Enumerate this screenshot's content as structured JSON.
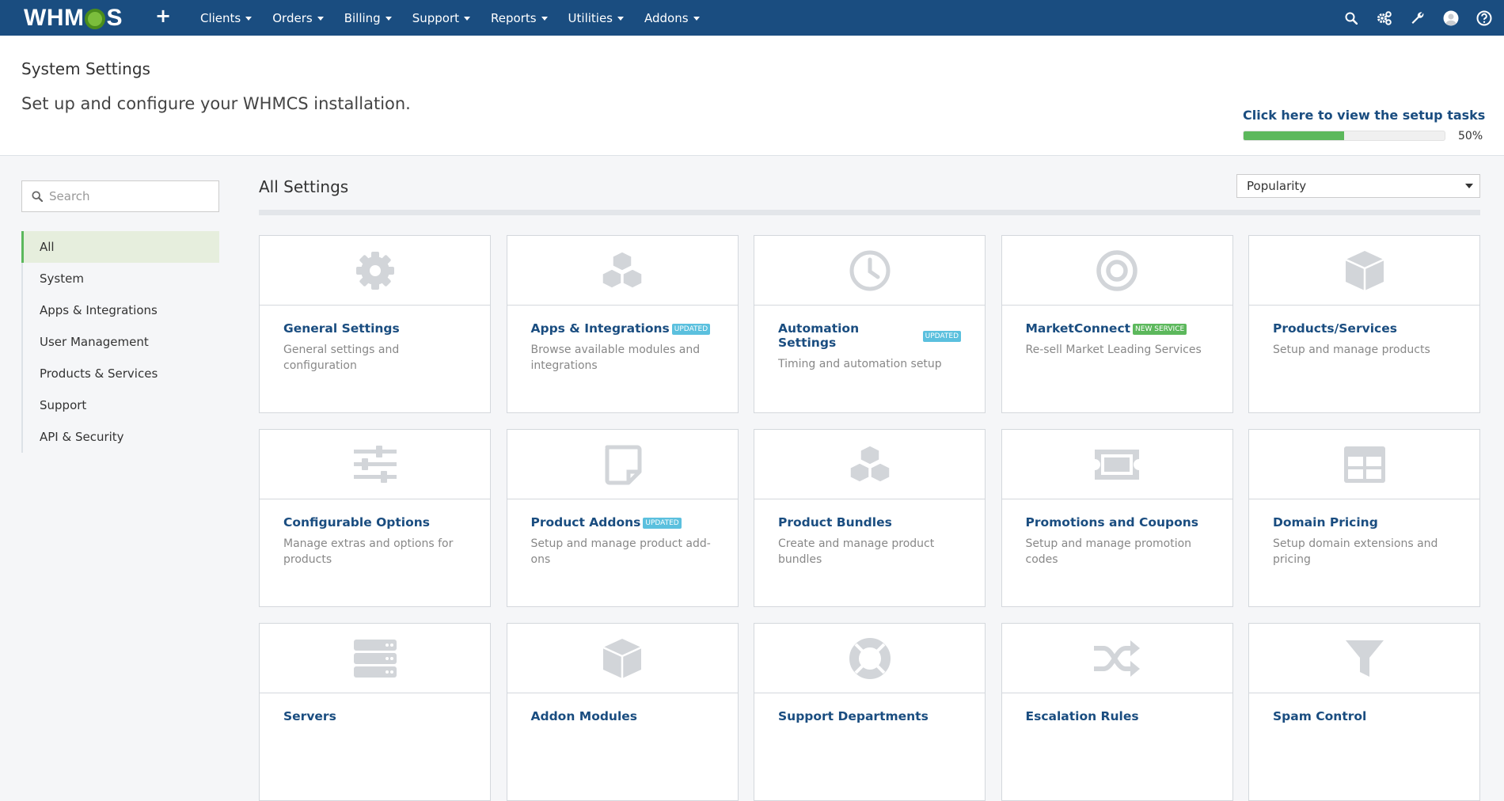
{
  "nav": {
    "logo_pre": "WHM",
    "logo_post": "S",
    "menu": [
      {
        "label": "Clients"
      },
      {
        "label": "Orders"
      },
      {
        "label": "Billing"
      },
      {
        "label": "Support"
      },
      {
        "label": "Reports"
      },
      {
        "label": "Utilities"
      },
      {
        "label": "Addons"
      }
    ]
  },
  "header": {
    "title": "System Settings",
    "subtitle": "Set up and configure your WHMCS installation.",
    "setup_link": "Click here to view the setup tasks",
    "progress_pct": "50%",
    "progress_value": 0.5
  },
  "sidebar": {
    "search_placeholder": "Search",
    "items": [
      {
        "label": "All"
      },
      {
        "label": "System"
      },
      {
        "label": "Apps & Integrations"
      },
      {
        "label": "User Management"
      },
      {
        "label": "Products & Services"
      },
      {
        "label": "Support"
      },
      {
        "label": "API & Security"
      }
    ]
  },
  "main": {
    "title": "All Settings",
    "sort_value": "Popularity",
    "cards": [
      {
        "title": "General Settings",
        "desc": "General settings and configuration",
        "badge": "",
        "icon": "gear-icon"
      },
      {
        "title": "Apps & Integrations",
        "desc": "Browse available modules and integrations",
        "badge": "UPDATED",
        "icon": "cubes-icon"
      },
      {
        "title": "Automation Settings",
        "desc": "Timing and automation setup",
        "badge": "UPDATED",
        "icon": "clock-icon"
      },
      {
        "title": "MarketConnect",
        "desc": "Re-sell Market Leading Services",
        "badge": "NEW SERVICE",
        "icon": "target-icon"
      },
      {
        "title": "Products/Services",
        "desc": "Setup and manage products",
        "badge": "",
        "icon": "cube-icon"
      },
      {
        "title": "Configurable Options",
        "desc": "Manage extras and options for products",
        "badge": "",
        "icon": "sliders-icon"
      },
      {
        "title": "Product Addons",
        "desc": "Setup and manage product add-ons",
        "badge": "UPDATED",
        "icon": "sticky-note-icon"
      },
      {
        "title": "Product Bundles",
        "desc": "Create and manage product bundles",
        "badge": "",
        "icon": "cubes-icon"
      },
      {
        "title": "Promotions and Coupons",
        "desc": "Setup and manage promotion codes",
        "badge": "",
        "icon": "ticket-icon"
      },
      {
        "title": "Domain Pricing",
        "desc": "Setup domain extensions and pricing",
        "badge": "",
        "icon": "table-icon"
      },
      {
        "title": "Servers",
        "desc": "",
        "badge": "",
        "icon": "server-icon"
      },
      {
        "title": "Addon Modules",
        "desc": "",
        "badge": "",
        "icon": "cube-icon"
      },
      {
        "title": "Support Departments",
        "desc": "",
        "badge": "",
        "icon": "life-ring-icon"
      },
      {
        "title": "Escalation Rules",
        "desc": "",
        "badge": "",
        "icon": "random-icon"
      },
      {
        "title": "Spam Control",
        "desc": "",
        "badge": "",
        "icon": "filter-icon"
      }
    ]
  }
}
